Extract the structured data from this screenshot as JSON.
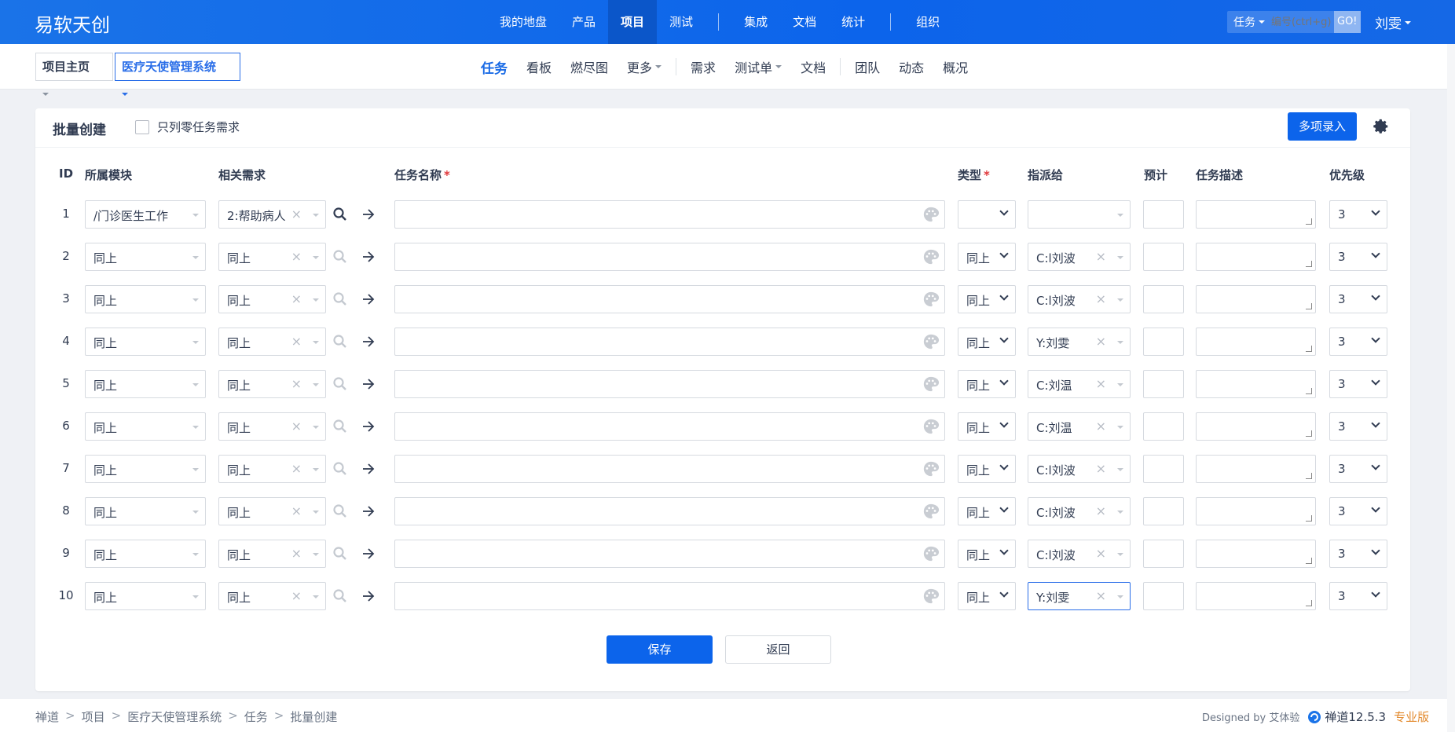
{
  "app": {
    "brand": "易软天创"
  },
  "mainnav": {
    "items": [
      "我的地盘",
      "产品",
      "项目",
      "测试",
      "集成",
      "文档",
      "统计",
      "组织"
    ],
    "active": "项目"
  },
  "search": {
    "type": "任务",
    "placeholder": "编号(ctrl+g)",
    "go": "GO!"
  },
  "user": {
    "name": "刘雯"
  },
  "subbar": {
    "home": "项目主页",
    "project": "医疗天使管理系统",
    "nav": [
      "任务",
      "看板",
      "燃尽图",
      "更多",
      "需求",
      "测试单",
      "文档",
      "团队",
      "动态",
      "概况"
    ]
  },
  "panel": {
    "title": "批量创建",
    "checkbox_label": "只列零任务需求",
    "multi_button": "多项录入"
  },
  "table": {
    "headers": {
      "id": "ID",
      "module": "所属模块",
      "story": "相关需求",
      "name": "任务名称",
      "type": "类型",
      "assign": "指派给",
      "estimate": "预计",
      "desc": "任务描述",
      "pri": "优先级"
    },
    "rows": [
      {
        "id": "1",
        "module": "/门诊医生工作",
        "story": "2:帮助病人",
        "name": "",
        "type": "",
        "assign": "",
        "pri": "3"
      },
      {
        "id": "2",
        "module": "同上",
        "story": "同上",
        "name": "",
        "type": "同上",
        "assign": "C:l刘波",
        "pri": "3"
      },
      {
        "id": "3",
        "module": "同上",
        "story": "同上",
        "name": "",
        "type": "同上",
        "assign": "C:l刘波",
        "pri": "3"
      },
      {
        "id": "4",
        "module": "同上",
        "story": "同上",
        "name": "",
        "type": "同上",
        "assign": "Y:刘雯",
        "pri": "3"
      },
      {
        "id": "5",
        "module": "同上",
        "story": "同上",
        "name": "",
        "type": "同上",
        "assign": "C:刘温",
        "pri": "3"
      },
      {
        "id": "6",
        "module": "同上",
        "story": "同上",
        "name": "",
        "type": "同上",
        "assign": "C:刘温",
        "pri": "3"
      },
      {
        "id": "7",
        "module": "同上",
        "story": "同上",
        "name": "",
        "type": "同上",
        "assign": "C:l刘波",
        "pri": "3"
      },
      {
        "id": "8",
        "module": "同上",
        "story": "同上",
        "name": "",
        "type": "同上",
        "assign": "C:l刘波",
        "pri": "3"
      },
      {
        "id": "9",
        "module": "同上",
        "story": "同上",
        "name": "",
        "type": "同上",
        "assign": "C:l刘波",
        "pri": "3"
      },
      {
        "id": "10",
        "module": "同上",
        "story": "同上",
        "name": "",
        "type": "同上",
        "assign": "Y:刘雯",
        "pri": "3"
      }
    ]
  },
  "actions": {
    "save": "保存",
    "back": "返回"
  },
  "footer": {
    "crumbs": [
      "禅道",
      "项目",
      "医疗天使管理系统",
      "任务",
      "批量创建"
    ],
    "designed": "Designed by 艾体验",
    "version": "禅道12.5.3",
    "edition": "专业版"
  },
  "colors": {
    "primary": "#0c64eb",
    "required": "#e0363a",
    "edition": "#e38b2f"
  }
}
